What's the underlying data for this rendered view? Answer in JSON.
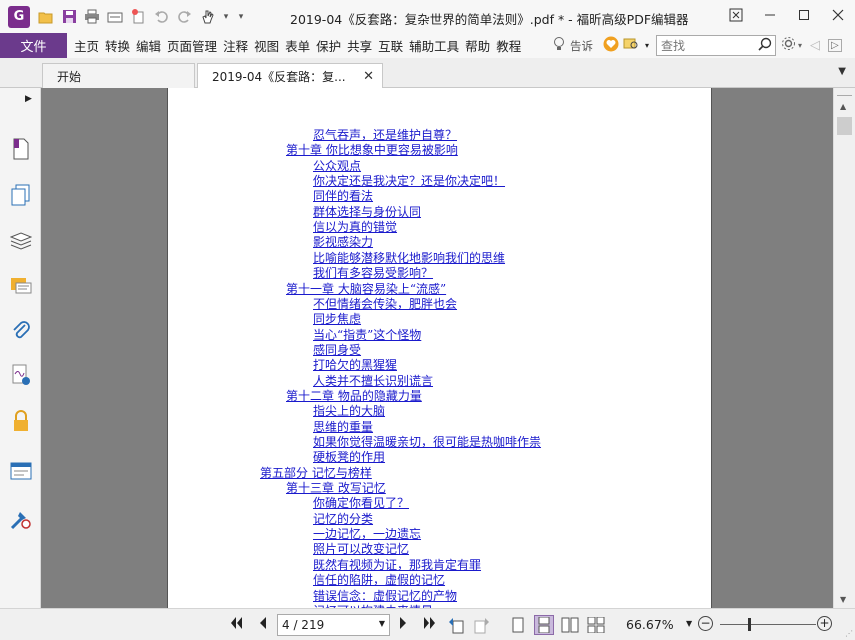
{
  "window": {
    "title": "2019-04《反套路：复杂世界的简单法则》.pdf * - 福昕高级PDF编辑器",
    "logo_letter": "G"
  },
  "menu": {
    "file_label": "文件",
    "items": [
      "主页",
      "转换",
      "编辑",
      "页面管理",
      "注释",
      "视图",
      "表单",
      "保护",
      "共享",
      "互联",
      "辅助工具",
      "帮助",
      "教程"
    ],
    "tell_me": "告诉",
    "search_placeholder": "查找"
  },
  "tabs": [
    {
      "label": "开始"
    },
    {
      "label": "2019-04《反套路：复..."
    }
  ],
  "toc": [
    {
      "text": "忍气吞声，还是维护自尊？",
      "level": 3
    },
    {
      "text": "第十章 你比想象中更容易被影响",
      "level": 2
    },
    {
      "text": "公众观点",
      "level": 3
    },
    {
      "text": "你决定还是我决定？还是你决定吧！",
      "level": 3
    },
    {
      "text": "同伴的看法",
      "level": 3
    },
    {
      "text": "群体选择与身份认同",
      "level": 3
    },
    {
      "text": "信以为真的错觉",
      "level": 3
    },
    {
      "text": "影视感染力",
      "level": 3
    },
    {
      "text": "比喻能够潜移默化地影响我们的思维",
      "level": 3
    },
    {
      "text": "我们有多容易受影响？",
      "level": 3
    },
    {
      "text": "第十一章 大脑容易染上“流感”",
      "level": 2
    },
    {
      "text": "不但情绪会传染，肥胖也会",
      "level": 3
    },
    {
      "text": "同步焦虑",
      "level": 3
    },
    {
      "text": "当心“指责”这个怪物",
      "level": 3
    },
    {
      "text": "感同身受",
      "level": 3
    },
    {
      "text": "打哈欠的黑猩猩",
      "level": 3
    },
    {
      "text": "人类并不擅长识别谎言",
      "level": 3
    },
    {
      "text": "第十二章 物品的隐藏力量",
      "level": 2
    },
    {
      "text": "指尖上的大脑",
      "level": 3
    },
    {
      "text": "思维的重量",
      "level": 3
    },
    {
      "text": "如果你觉得温暖亲切，很可能是热咖啡作祟",
      "level": 3
    },
    {
      "text": "硬板凳的作用",
      "level": 3
    },
    {
      "text": "第五部分 记忆与榜样",
      "level": 1
    },
    {
      "text": "第十三章 改写记忆",
      "level": 2
    },
    {
      "text": "你确定你看见了？",
      "level": 3
    },
    {
      "text": "记忆的分类",
      "level": 3
    },
    {
      "text": "一边记忆，一边遗忘",
      "level": 3
    },
    {
      "text": "照片可以改变记忆",
      "level": 3
    },
    {
      "text": "既然有视频为证，那我肯定有罪",
      "level": 3
    },
    {
      "text": "信任的陷阱，虚假的记忆",
      "level": 3
    },
    {
      "text": "错误信念：虚假记忆的产物",
      "level": 3
    },
    {
      "text": "记忆可以构建未来情景",
      "level": 3
    }
  ],
  "status": {
    "page_indicator": "4 / 219",
    "zoom": "66.67%"
  }
}
